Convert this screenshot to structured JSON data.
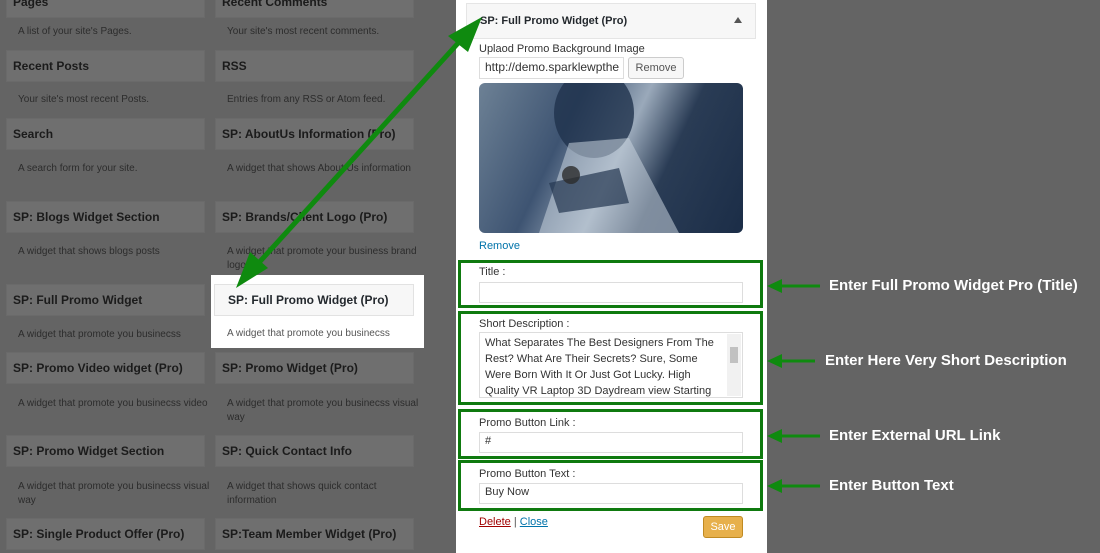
{
  "widget_list": {
    "items": [
      {
        "title": "Pages",
        "desc": "A list of your site's Pages."
      },
      {
        "title": "Recent Comments",
        "desc": "Your site's most recent comments."
      },
      {
        "title": "Recent Posts",
        "desc": "Your site's most recent Posts."
      },
      {
        "title": "RSS",
        "desc": "Entries from any RSS or Atom feed."
      },
      {
        "title": "Search",
        "desc": "A search form for your site."
      },
      {
        "title": "SP: AboutUs Information (Pro)",
        "desc": "A widget that shows About Us information"
      },
      {
        "title": "SP: Blogs Widget Section",
        "desc": "A widget that shows blogs posts"
      },
      {
        "title": "SP: Brands/Client Logo (Pro)",
        "desc": "A widget that promote your business brand logo"
      },
      {
        "title": "SP: Full Promo Widget",
        "desc": "A widget that promote you businecss"
      },
      {
        "title": "SP: Full Promo Widget (Pro)",
        "desc": "A widget that promote you businecss"
      },
      {
        "title": "SP: Promo Video widget (Pro)",
        "desc": "A widget that promote you businecss video"
      },
      {
        "title": "SP: Promo Widget (Pro)",
        "desc": "A widget that promote you businecss visual way"
      },
      {
        "title": "SP: Promo Widget Section",
        "desc": "A widget that promote you businecss visual way"
      },
      {
        "title": "SP: Quick Contact Info",
        "desc": "A widget that shows quick contact information"
      },
      {
        "title": "SP: Single Product Offer (Pro)",
        "desc": ""
      },
      {
        "title": "SP:Team Member Widget (Pro)",
        "desc": ""
      }
    ]
  },
  "panel": {
    "title": "SP: Full Promo Widget (Pro)",
    "bg_label": "Uplaod Promo Background Image",
    "bg_url": "http://demo.sparklewpthe",
    "remove_button": "Remove",
    "remove_link": "Remove",
    "title_label": "Title :",
    "title_value": "",
    "short_desc_label": "Short Description :",
    "short_desc_value": "What Separates The Best Designers From The Rest? What Are Their Secrets? Sure, Some Were Born With It Or Just Got Lucky. High Quality VR Laptop 3D Daydream view Starting",
    "link_label": "Promo Button Link :",
    "link_value": "#",
    "button_text_label": "Promo Button Text :",
    "button_text_value": "Buy Now",
    "delete_link": "Delete",
    "separator": "|",
    "close_link": "Close",
    "save_button": "Save"
  },
  "annotations": {
    "title": "Enter Full Promo Widget Pro (Title)",
    "short_desc": "Enter Here Very Short Description",
    "link": "Enter External URL Link",
    "button_text": "Enter Button Text"
  },
  "colors": {
    "annotation_green": "#0f7a0f",
    "save_button": "#e7b04b",
    "link_blue": "#0073aa",
    "delete_red": "#a00000"
  }
}
